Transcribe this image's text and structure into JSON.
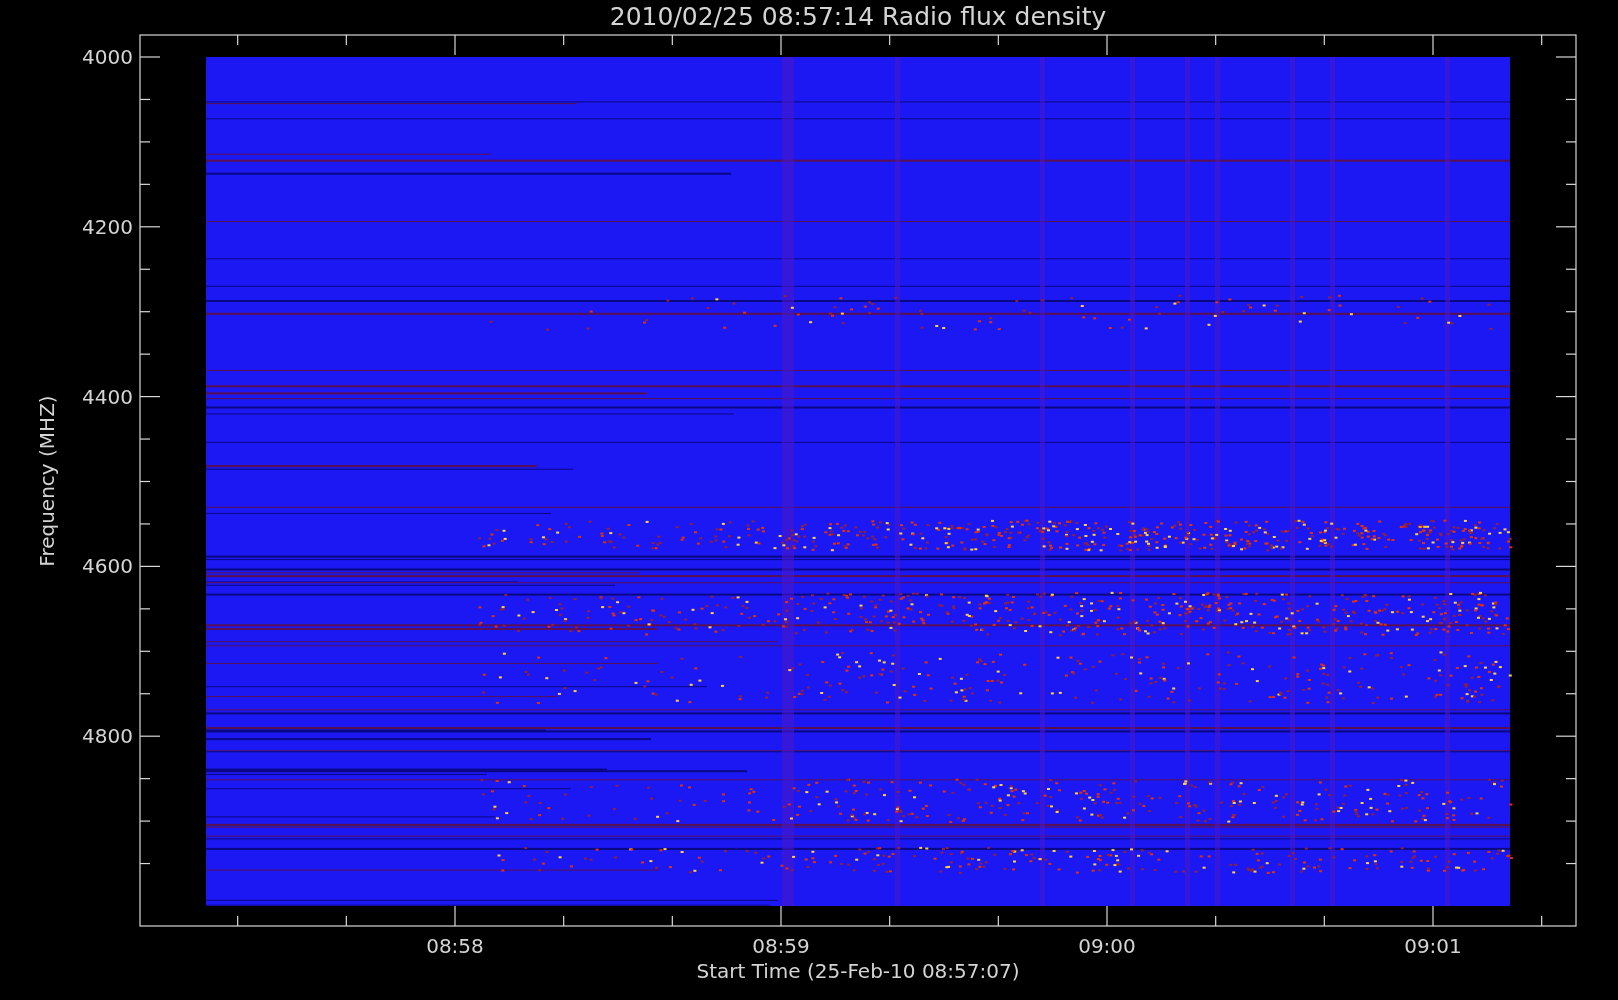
{
  "plot": {
    "title": "2010/02/25 08:57:14 Radio flux density",
    "ylabel": "Frequency (MHZ)",
    "yticks": [
      "4000",
      "4200",
      "4400",
      "4600",
      "4800"
    ],
    "xticks": [
      "08:58",
      "08:59",
      "09:00",
      "09:01"
    ],
    "xlabel": "Start Time (25-Feb-10 08:57:07)"
  }
}
